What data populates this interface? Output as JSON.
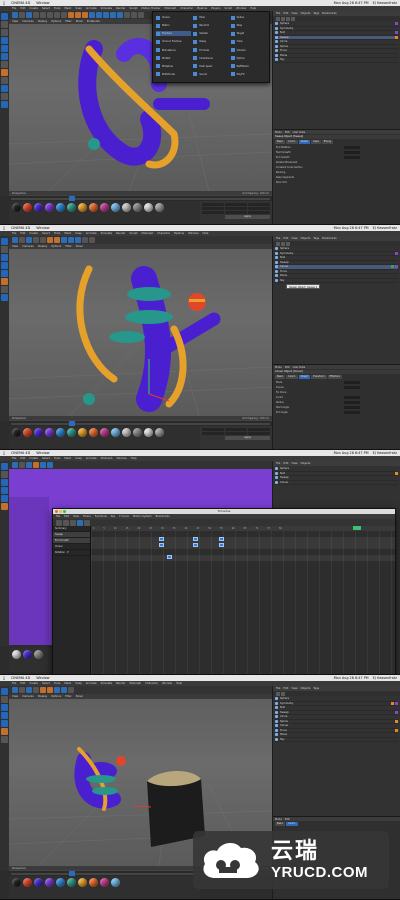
{
  "app": {
    "name": "CINEMA 4D",
    "menu": "Window",
    "clock": "Mon Aug 28 6:47 PM",
    "user": "EJ Hassenfratz",
    "title": "C4D Scene"
  },
  "menus": [
    "File",
    "Edit",
    "Create",
    "Select",
    "Tools",
    "Mesh",
    "Snap",
    "Animate",
    "Simulate",
    "Render",
    "Sculpt",
    "Motion Tracker",
    "MoGraph",
    "Character",
    "Pipeline",
    "Plugins",
    "Script",
    "Window",
    "Help"
  ],
  "viewport": {
    "menu": [
      "View",
      "Cameras",
      "Display",
      "Options",
      "Filter",
      "Panel",
      "ProRender"
    ],
    "label": "Perspective",
    "grid_spacing": "Grid Spacing : 100 cm"
  },
  "object_manager": {
    "tabs": [
      "File",
      "Edit",
      "View",
      "Objects",
      "Tags",
      "Bookmarks"
    ],
    "objects": [
      "Sphere",
      "Symmetry",
      "Null",
      "Sweep",
      "Circle",
      "Spline",
      "Cloner",
      "Torus",
      "Plane",
      "Sky"
    ]
  },
  "attributes": {
    "header": [
      "Mode",
      "Edit",
      "User Data"
    ],
    "title_1": "Sweep Object [Sweep]",
    "tabs_1": [
      "Basic",
      "Coord.",
      "Object",
      "Caps",
      "Phong"
    ],
    "fields_1": [
      "End Rotation",
      "Start Growth",
      "End Growth",
      "Parallel Movement",
      "Constant Cross Section",
      "Banking",
      "Keep Segments",
      "Stick UVs"
    ],
    "title_2": "Cloner Object [Cloner]",
    "tabs_2": [
      "Basic",
      "Coord.",
      "Object",
      "Transform",
      "Effectors"
    ],
    "fields_2": [
      "Mode",
      "Clones",
      "Fix Clone",
      "Count",
      "Radius",
      "Start Angle",
      "End Angle"
    ]
  },
  "dropdown": {
    "items": [
      "Cloner",
      "Matrix",
      "Fracture",
      "Voronoi Fracture",
      "MoInstance",
      "MoText",
      "MoSpline",
      "MoExtrude",
      "PolyFX",
      "Plain",
      "Random",
      "Shader",
      "Delay",
      "Formula",
      "Inheritance",
      "Push Apart",
      "ReEffector",
      "Sound",
      "Spline",
      "Step",
      "Target",
      "Time",
      "Volume",
      "Python"
    ],
    "highlighted": "Fracture"
  },
  "tooltip": "Sweep Object: Sweep.1",
  "timeline": {
    "title": "Timeline",
    "menu": [
      "File",
      "Edit",
      "View",
      "Frame",
      "Functions",
      "Key",
      "F-Curve",
      "Motion System",
      "Bookmarks"
    ],
    "tracks": [
      "Summary",
      "Sweep",
      "End Growth",
      "Cloner",
      "Rotation . P"
    ],
    "ruler": [
      "0",
      "5",
      "10",
      "15",
      "20",
      "25",
      "30",
      "35",
      "40",
      "45",
      "50",
      "55",
      "60",
      "65",
      "70",
      "75",
      "80",
      "85",
      "90"
    ]
  },
  "materials_menu": [
    "Create",
    "Edit",
    "Function",
    "Texture"
  ],
  "apply": "Apply",
  "materials": [
    {
      "name": "Mat",
      "color": "#222222"
    },
    {
      "name": "Mat",
      "color": "#e0472a"
    },
    {
      "name": "Mat",
      "color": "#4a2ad0"
    },
    {
      "name": "Mat",
      "color": "#7e3ad9"
    },
    {
      "name": "Mat",
      "color": "#2f87d6"
    },
    {
      "name": "Mat",
      "color": "#2e9c8c"
    },
    {
      "name": "Mat",
      "color": "#e7a22a"
    },
    {
      "name": "Mat",
      "color": "#e86c2c"
    },
    {
      "name": "Mat",
      "color": "#c43a8f"
    },
    {
      "name": "Mat",
      "color": "#6fb6e8"
    },
    {
      "name": "Mat",
      "color": "#c8c8c8"
    },
    {
      "name": "Mat",
      "color": "#8a8a8a"
    },
    {
      "name": "Mat",
      "color": "#dddddd"
    },
    {
      "name": "Mat",
      "color": "#a0a0a0"
    }
  ],
  "watermark": {
    "cn": "云瑞",
    "en": "YRUCD.COM"
  },
  "colors": {
    "purple": "#4a1fd0",
    "gold": "#e6a12a",
    "teal": "#27968b",
    "accent": "#2d6db5"
  }
}
